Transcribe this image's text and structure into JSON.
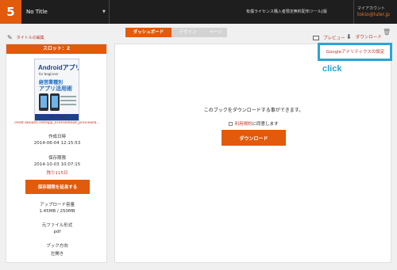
{
  "header": {
    "slot_number": "5",
    "title_select": "No Title",
    "license_info": "有償ライセンス購入者限定無料配布ツール[版",
    "account_label": "マイアカウント",
    "account_email": "tokio@luler.jp"
  },
  "toolbar": {
    "edit_title": "タイトルの編集",
    "tabs": [
      "ダッシュボード",
      "デザイン",
      "ページ"
    ],
    "preview": "プレビュー",
    "download": "ダウンロード"
  },
  "sidebar": {
    "slot_header": "スロット：2",
    "cover": {
      "title_en": "Androidアプリ",
      "subtitle": "for beginner",
      "jp_line1": "経営業種別",
      "jp_line2": "アプリ活用術"
    },
    "book_title": "No Title",
    "url": "//edit.ebook5.net/app_license/book_preview/b…",
    "created_label": "作成日時",
    "created_value": "2014-06-04 12:15:53",
    "retention_label": "保存期限",
    "retention_value": "2014-10-03 10:07:15",
    "remaining": "残り115日",
    "extend_button": "保存期限を延長する",
    "upload_label": "アップロード容量",
    "upload_value": "1.45MB / 250MB",
    "source_format_label": "元ファイル形式",
    "source_format_value": "pdf",
    "direction_label": "ブック方向",
    "direction_value": "左開き"
  },
  "main": {
    "ga_link": "Googleアナリティクスの設定",
    "download_prompt": "このブックをダウンロードする事ができます。",
    "terms_link": "利用規約",
    "terms_suffix": "に同意します",
    "download_button": "ダウンロード"
  },
  "annotation": {
    "callout_text": "click"
  },
  "colors": {
    "accent": "#e25a0c",
    "link": "#c0392b",
    "topbar": "#1e1e1e",
    "callout": "#2aa3d8"
  }
}
